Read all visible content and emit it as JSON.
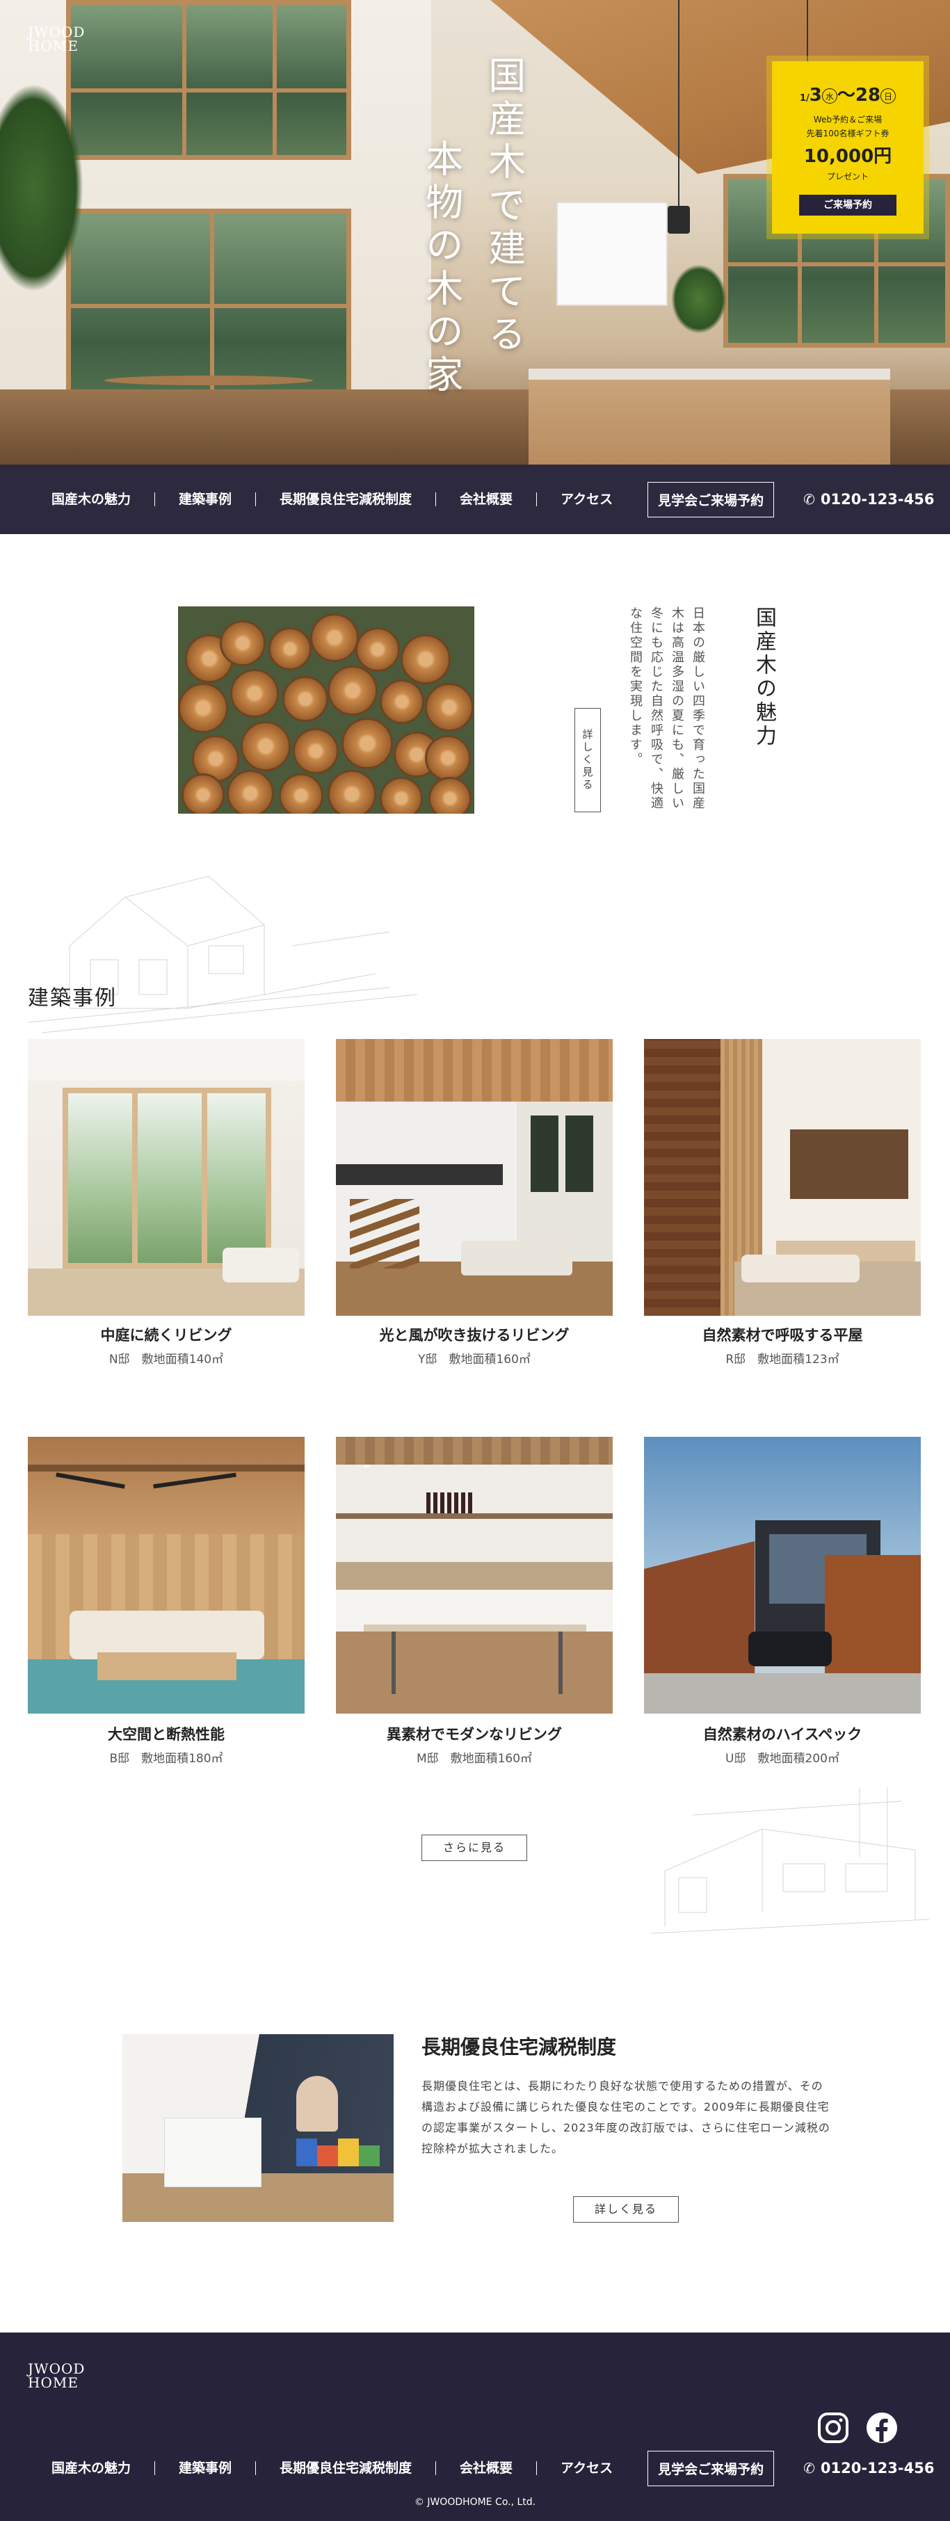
{
  "hero": {
    "logo": [
      "JWOOD",
      "HOME"
    ],
    "title_col1": "国産木で建てる",
    "title_col2": "本物の木の家"
  },
  "promo": {
    "date_start_month": "1",
    "date_start_day": "3",
    "date_start_weekday": "水",
    "date_end_day": "28",
    "date_end_weekday": "日",
    "line1": "Web予約＆ご来場",
    "line2": "先着100名様ギフト券",
    "amount": "10,000円",
    "line3": "プレゼント",
    "button": "ご来場予約",
    "color": "#f5d400"
  },
  "nav": {
    "items": [
      "国産木の魅力",
      "建築事例",
      "長期優良住宅減税制度",
      "会社概要",
      "アクセス"
    ],
    "visit_button": "見学会ご来場予約",
    "phone": "0120-123-456",
    "bg_color": "#26233a"
  },
  "charm": {
    "title": "国産木の魅力",
    "text": "日本の厳しい四季で育った国産木は高温多湿の夏にも、厳しい冬にも応じた自然呼吸で、快適な住空間を実現します。",
    "button": "詳しく見る"
  },
  "cases": {
    "title": "建築事例",
    "items": [
      {
        "title": "中庭に続くリビング",
        "owner": "N邸",
        "area": "敷地面積140㎡"
      },
      {
        "title": "光と風が吹き抜けるリビング",
        "owner": "Y邸",
        "area": "敷地面積160㎡"
      },
      {
        "title": "自然素材で呼吸する平屋",
        "owner": "R邸",
        "area": "敷地面積123㎡"
      },
      {
        "title": "大空間と断熱性能",
        "owner": "B邸",
        "area": "敷地面積180㎡"
      },
      {
        "title": "異素材でモダンなリビング",
        "owner": "M邸",
        "area": "敷地面積160㎡"
      },
      {
        "title": "自然素材のハイスペック",
        "owner": "U邸",
        "area": "敷地面積200㎡"
      }
    ],
    "more_button": "さらに見る"
  },
  "tax": {
    "title": "長期優良住宅減税制度",
    "text": "長期優良住宅とは、長期にわたり良好な状態で使用するための措置が、その構造および設備に講じられた優良な住宅のことです。2009年に長期優良住宅の認定事業がスタートし、2023年度の改訂版では、さらに住宅ローン減税の控除枠が拡大されました。",
    "button": "詳しく見る"
  },
  "footer": {
    "logo": [
      "JWOOD",
      "HOME"
    ],
    "copyright": "© JWOODHOME Co., Ltd.",
    "social": [
      "instagram-icon",
      "facebook-icon"
    ]
  }
}
